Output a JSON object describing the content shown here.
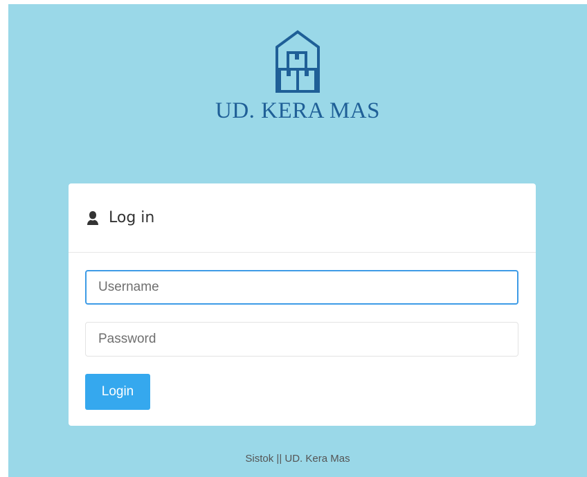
{
  "brand": {
    "name": "UD. KERA MAS",
    "icon": "warehouse-boxes-icon",
    "color": "#1f5f97"
  },
  "login_panel": {
    "title": "Log in",
    "title_icon": "user-icon",
    "username": {
      "value": "",
      "placeholder": "Username"
    },
    "password": {
      "value": "",
      "placeholder": "Password"
    },
    "submit_label": "Login"
  },
  "footer": {
    "text": "Sistok || UD. Kera Mas"
  },
  "colors": {
    "background": "#9ad8e8",
    "panel": "#ffffff",
    "button": "#35a8ee",
    "focus_border": "#3d9be6"
  }
}
